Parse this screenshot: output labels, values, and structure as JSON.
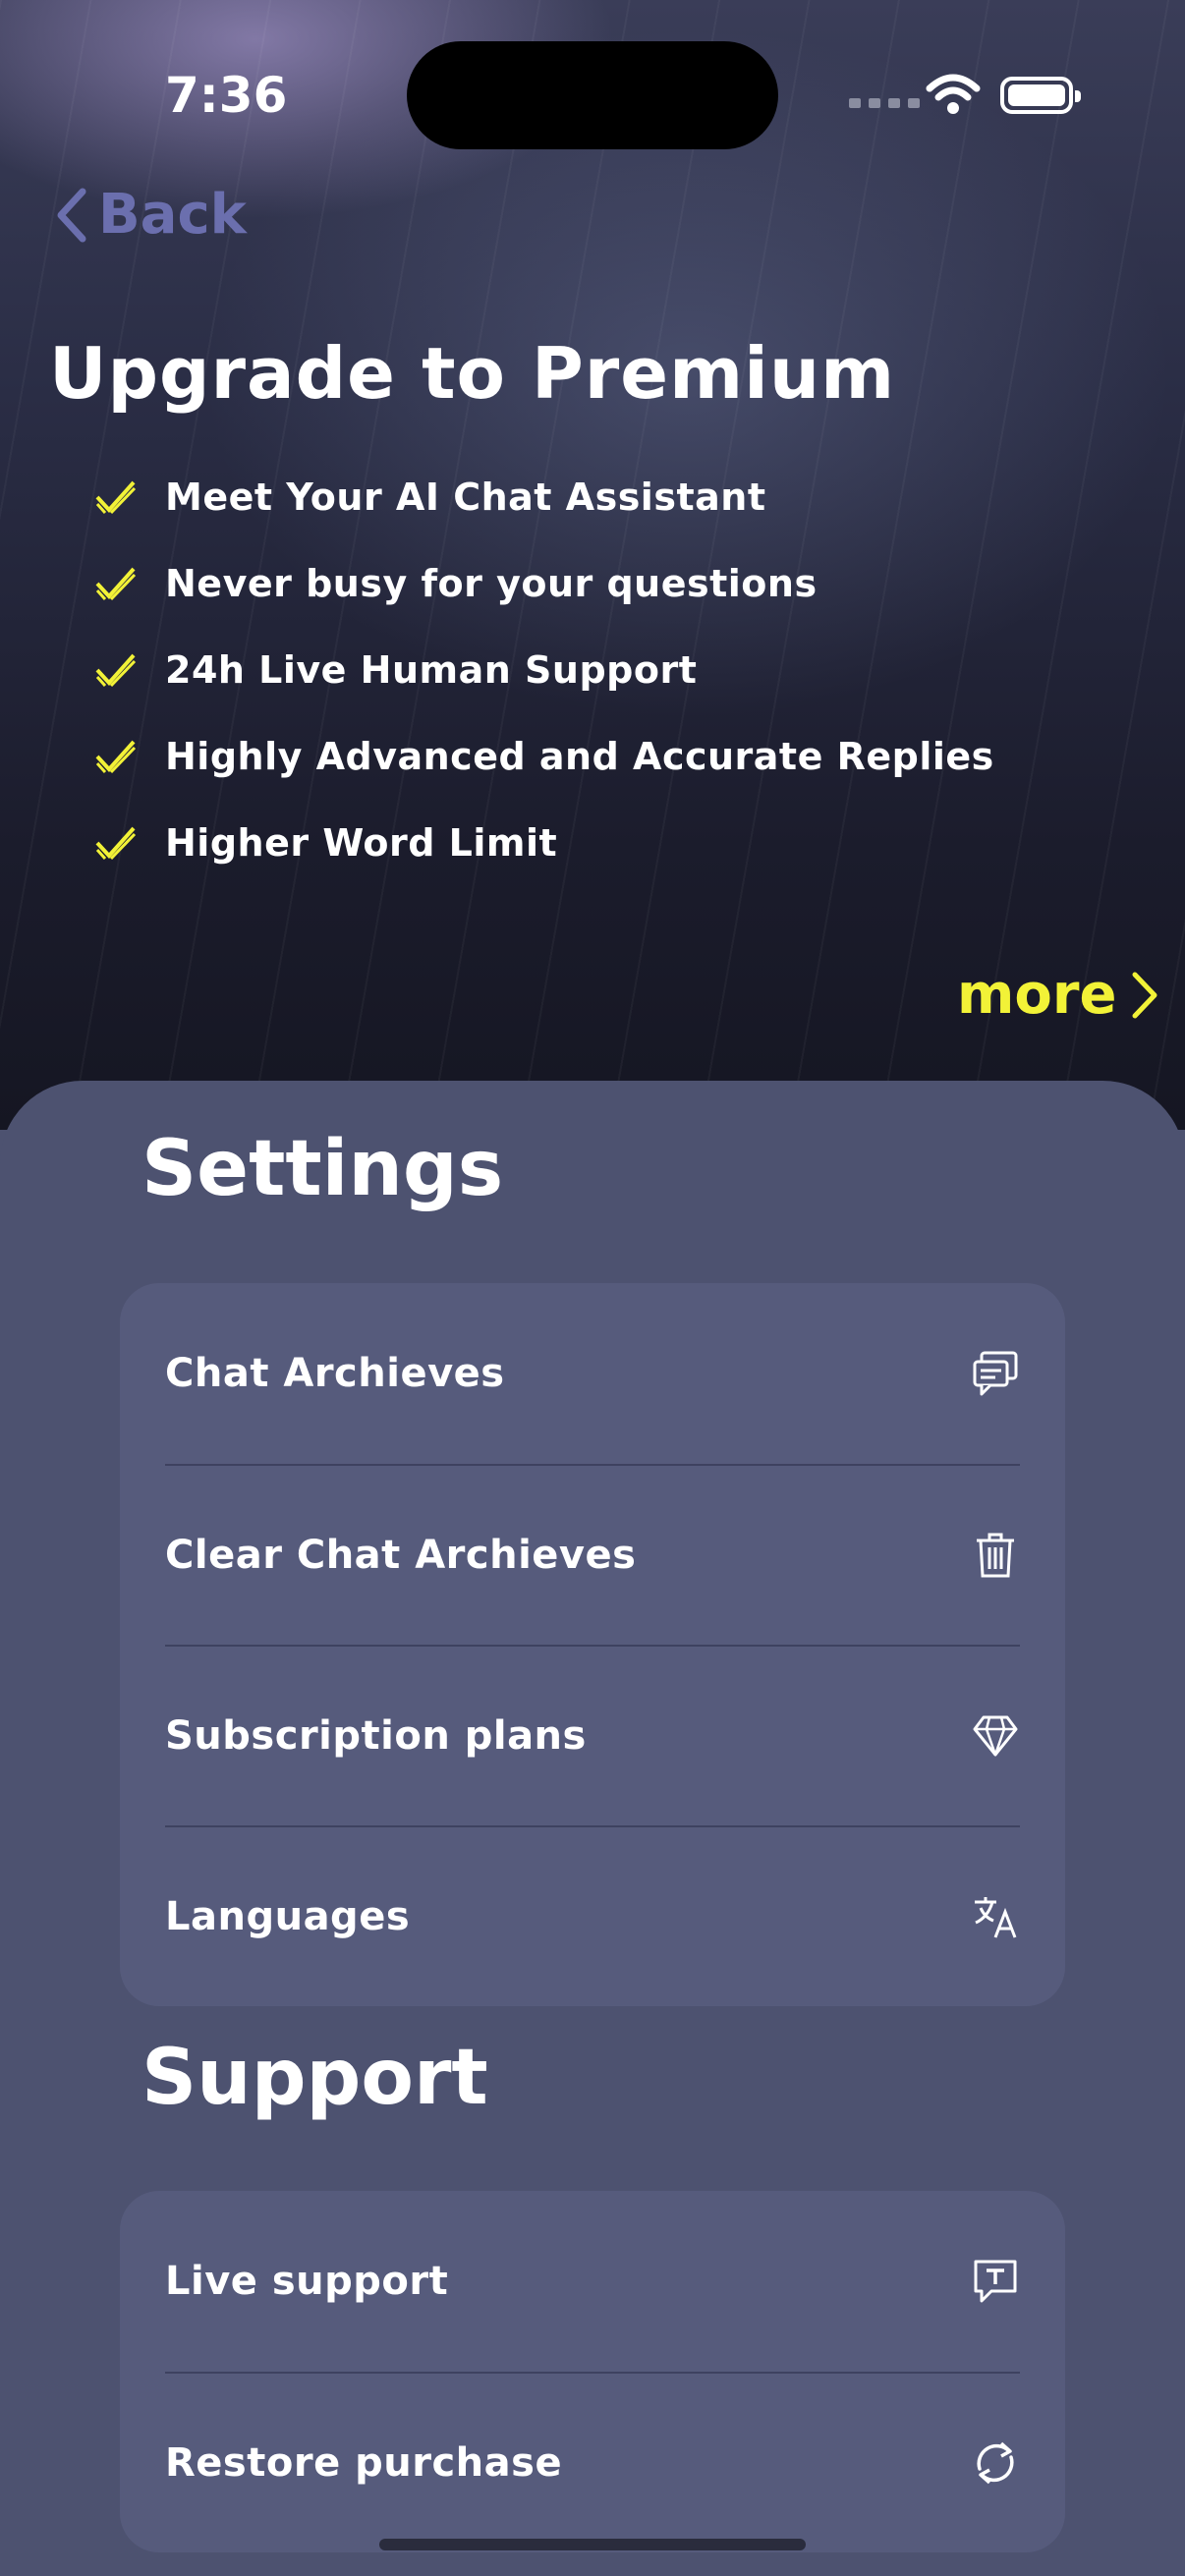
{
  "status_bar": {
    "time": "7:36"
  },
  "nav": {
    "back_label": "Back"
  },
  "premium": {
    "title": "Upgrade to Premium",
    "features": [
      "Meet Your AI Chat Assistant",
      "Never busy for your questions",
      "24h Live Human Support",
      "Highly Advanced and Accurate Replies",
      "Higher Word Limit"
    ],
    "more_label": "more",
    "accent_color": "#f2f237"
  },
  "settings": {
    "title": "Settings",
    "items": [
      {
        "label": "Chat Archieves",
        "icon": "chat-bubbles-icon"
      },
      {
        "label": "Clear Chat Archieves",
        "icon": "trash-icon"
      },
      {
        "label": "Subscription plans",
        "icon": "diamond-icon"
      },
      {
        "label": "Languages",
        "icon": "translate-icon"
      }
    ]
  },
  "support": {
    "title": "Support",
    "items": [
      {
        "label": "Live support",
        "icon": "text-message-icon"
      },
      {
        "label": "Restore purchase",
        "icon": "refresh-icon"
      }
    ]
  }
}
